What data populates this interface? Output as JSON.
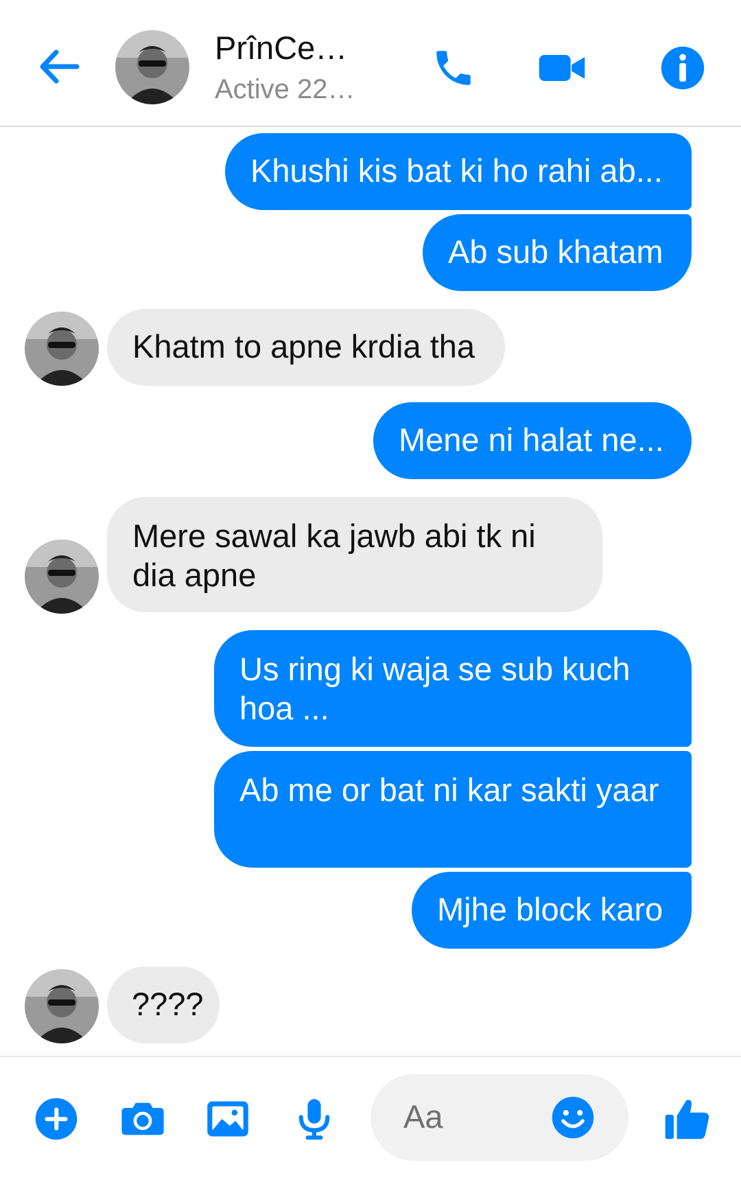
{
  "header": {
    "contact_name": "PrînCe…",
    "status": "Active 22…",
    "back_icon": "arrow-left-icon",
    "call_icon": "phone-icon",
    "video_icon": "video-camera-icon",
    "info_icon": "info-icon"
  },
  "messages": [
    {
      "from": "me",
      "text": "Khushi kis bat ki ho rahi ab..."
    },
    {
      "from": "me",
      "text": "Ab sub khatam"
    },
    {
      "from": "contact",
      "text": "Khatm to apne krdia tha"
    },
    {
      "from": "me",
      "text": "Mene ni halat ne..."
    },
    {
      "from": "contact",
      "text": "Mere sawal ka jawb abi tk ni dia apne"
    },
    {
      "from": "me",
      "text": "Us ring ki waja se sub kuch hoa ..."
    },
    {
      "from": "me",
      "text": "Ab me or bat ni kar sakti yaar"
    },
    {
      "from": "me",
      "text": "Mjhe block karo"
    },
    {
      "from": "contact",
      "text": "????"
    }
  ],
  "composer": {
    "placeholder": "Aa",
    "icons": [
      "plus-circle-icon",
      "camera-icon",
      "image-icon",
      "microphone-icon",
      "emoji-icon",
      "thumbs-up-icon"
    ]
  },
  "colors": {
    "accent": "#0084ff",
    "incoming_bubble": "#ebebeb",
    "outgoing_text": "#ffffff"
  }
}
